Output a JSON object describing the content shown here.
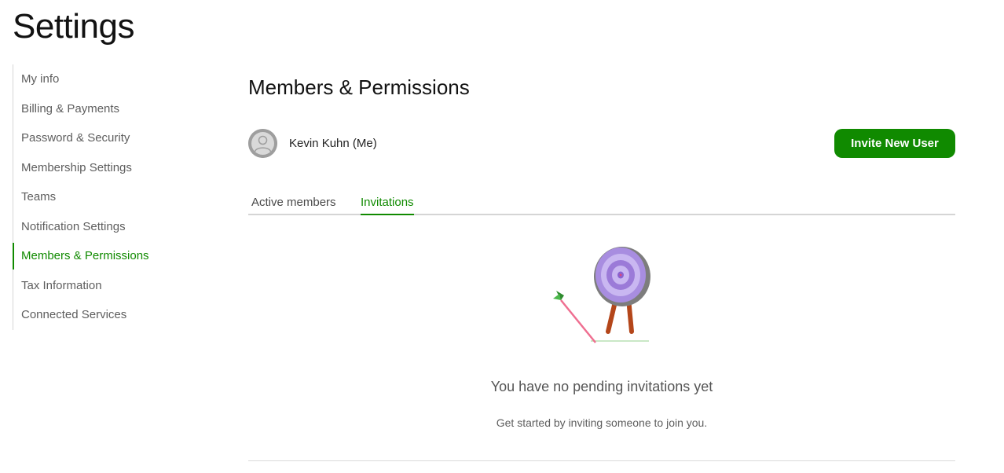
{
  "page": {
    "title": "Settings"
  },
  "sidebar": {
    "items": [
      {
        "label": "My info",
        "active": false
      },
      {
        "label": "Billing & Payments",
        "active": false
      },
      {
        "label": "Password & Security",
        "active": false
      },
      {
        "label": "Membership Settings",
        "active": false
      },
      {
        "label": "Teams",
        "active": false
      },
      {
        "label": "Notification Settings",
        "active": false
      },
      {
        "label": "Members & Permissions",
        "active": true
      },
      {
        "label": "Tax Information",
        "active": false
      },
      {
        "label": "Connected Services",
        "active": false
      }
    ]
  },
  "main": {
    "title": "Members & Permissions",
    "user": {
      "name": "Kevin Kuhn (Me)",
      "avatar_icon": "user-silhouette-icon"
    },
    "invite_button_label": "Invite New User",
    "tabs": [
      {
        "label": "Active members",
        "active": false
      },
      {
        "label": "Invitations",
        "active": true
      }
    ],
    "empty_state": {
      "illustration": "target-with-arrow-icon",
      "title": "You have no pending invitations yet",
      "subtitle": "Get started by inviting someone to join you."
    }
  },
  "colors": {
    "accent": "#108a00",
    "text_muted": "#5e5e5e",
    "divider": "#d5d5d5"
  }
}
